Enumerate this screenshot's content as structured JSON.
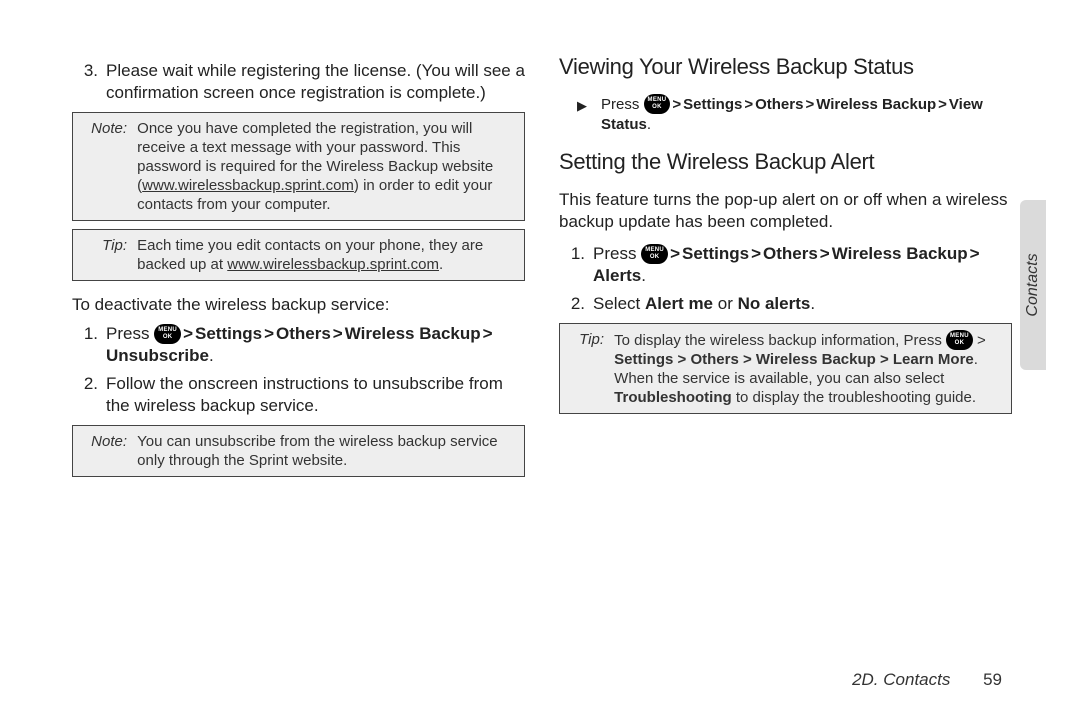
{
  "key_label_top": "MENU",
  "key_label_bottom": "OK",
  "left": {
    "item3_num": "3.",
    "item3_text": "Please wait while registering the license. (You will see a confirmation screen once registration is complete.)",
    "note1_label": "Note:",
    "note1_a": "Once you have completed the registration, you will receive a text message with your password. This password is required for the Wireless Backup website (",
    "note1_url": "www.wirelessbackup.sprint.com",
    "note1_b": ") in order to edit your contacts from your computer.",
    "tip1_label": "Tip:",
    "tip1_a": "Each time you edit contacts on your phone, they are backed up at ",
    "tip1_url": "www.wirelessbackup.sprint.com",
    "tip1_b": ".",
    "deact_heading": "To deactivate the wireless backup service:",
    "d1_num": "1.",
    "d1_press": "Press ",
    "d1_sep": " > ",
    "d1_settings": "Settings",
    "d1_others": "Others",
    "d1_wb": "Wireless Backup",
    "d1_unsub": "Unsubscribe",
    "d1_period": ".",
    "d2_num": "2.",
    "d2_text": "Follow the onscreen instructions to unsubscribe from the wireless backup service.",
    "note2_label": "Note:",
    "note2_text": "You can unsubscribe from the wireless backup service only through the Sprint website."
  },
  "right": {
    "h_view": "Viewing Your Wireless Backup Status",
    "v_press": "Press ",
    "v_sep": " > ",
    "v_settings": "Settings",
    "v_others": "Others",
    "v_wb": "Wireless Backup",
    "v_vs": "View Status",
    "v_period": ".",
    "h_alert": "Setting the Wireless Backup Alert",
    "alert_para": "This feature turns the pop-up alert on or off when a wireless backup update has been completed.",
    "a1_num": "1.",
    "a1_press": "Press ",
    "a1_settings": "Settings",
    "a1_others": "Others",
    "a1_wb": "Wireless Backup",
    "a1_alerts": "Alerts",
    "a1_period": ".",
    "a2_num": "2.",
    "a2_select": "Select ",
    "a2_alertme": "Alert me",
    "a2_or": " or ",
    "a2_noalerts": "No alerts",
    "a2_period": ".",
    "tip2_label": "Tip:",
    "tip2_a": "To display the wireless backup information, Press ",
    "tip2_b": " > ",
    "tip2_path": "Settings > Others > Wireless Backup > Learn More",
    "tip2_c": ". When the service is available, you can also select ",
    "tip2_trouble": "Troubleshooting",
    "tip2_d": " to display the troubleshooting guide."
  },
  "sidetab": "Contacts",
  "footer_section": "2D. Contacts",
  "footer_page": "59"
}
